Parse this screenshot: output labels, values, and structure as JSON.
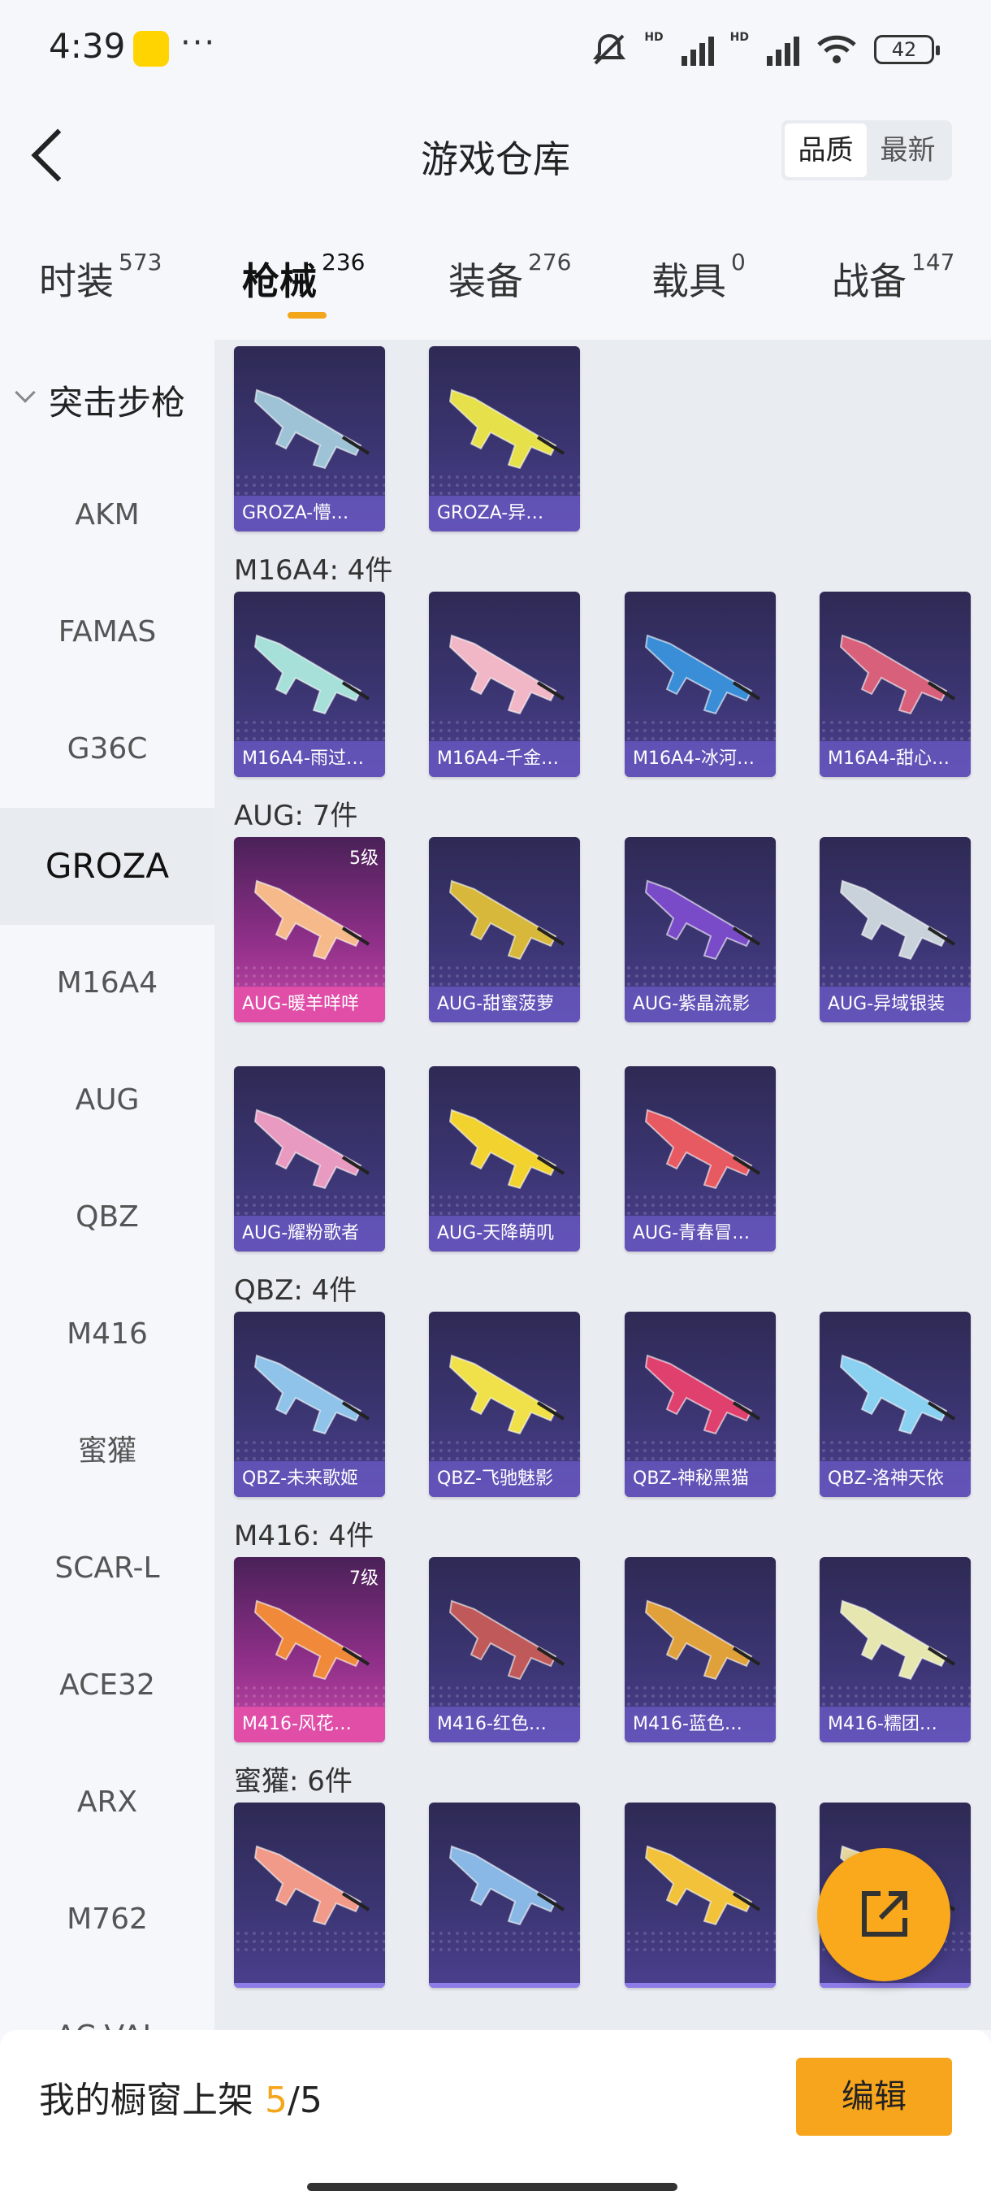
{
  "status": {
    "time": "4:39",
    "battery": "42",
    "hd1": "HD",
    "hd2": "HD"
  },
  "header": {
    "title": "游戏仓库",
    "seg": [
      "品质",
      "最新"
    ]
  },
  "tabs": [
    {
      "label": "时装",
      "count": "573"
    },
    {
      "label": "枪械",
      "count": "236"
    },
    {
      "label": "装备",
      "count": "276"
    },
    {
      "label": "载具",
      "count": "0"
    },
    {
      "label": "战备",
      "count": "147"
    }
  ],
  "sidebar": {
    "group": "突击步枪",
    "items": [
      "AKM",
      "FAMAS",
      "G36C",
      "GROZA",
      "M16A4",
      "AUG",
      "QBZ",
      "M416",
      "蜜獾",
      "SCAR-L",
      "ACE32",
      "ARX",
      "M762",
      "AC-VAL"
    ]
  },
  "sections": [
    {
      "title": "",
      "items": [
        {
          "name": "GROZA-懵…",
          "tone": "#9fc3d6",
          "level": ""
        },
        {
          "name": "GROZA-异…",
          "tone": "#e6e04a",
          "level": ""
        }
      ]
    },
    {
      "title": "M16A4: 4件",
      "items": [
        {
          "name": "M16A4-雨过…",
          "tone": "#a6e0d8",
          "level": ""
        },
        {
          "name": "M16A4-千金…",
          "tone": "#f2b7c6",
          "level": ""
        },
        {
          "name": "M16A4-冰河…",
          "tone": "#3a8ed8",
          "level": ""
        },
        {
          "name": "M16A4-甜心…",
          "tone": "#d8607a",
          "level": ""
        }
      ]
    },
    {
      "title": "AUG: 7件",
      "items": [
        {
          "name": "AUG-暖羊咩咩",
          "tone": "#f6b98a",
          "level": "5级"
        },
        {
          "name": "AUG-甜蜜菠萝",
          "tone": "#d8b83a",
          "level": ""
        },
        {
          "name": "AUG-紫晶流影",
          "tone": "#7a4bc8",
          "level": ""
        },
        {
          "name": "AUG-异域银装",
          "tone": "#c9d2da",
          "level": ""
        },
        {
          "name": "AUG-耀粉歌者",
          "tone": "#e89ac0",
          "level": ""
        },
        {
          "name": "AUG-天降萌叽",
          "tone": "#f2d22e",
          "level": ""
        },
        {
          "name": "AUG-青春冒…",
          "tone": "#e85a62",
          "level": ""
        }
      ]
    },
    {
      "title": "QBZ: 4件",
      "items": [
        {
          "name": "QBZ-未来歌姬",
          "tone": "#8fc3ea",
          "level": ""
        },
        {
          "name": "QBZ-飞驰魅影",
          "tone": "#f0e04a",
          "level": ""
        },
        {
          "name": "QBZ-神秘黑猫",
          "tone": "#e0406e",
          "level": ""
        },
        {
          "name": "QBZ-洛神天依",
          "tone": "#8ad0f0",
          "level": ""
        }
      ]
    },
    {
      "title": "M416: 4件",
      "items": [
        {
          "name": "M416-风花…",
          "tone": "#f08a3a",
          "level": "7级"
        },
        {
          "name": "M416-红色…",
          "tone": "#c05a5a",
          "level": ""
        },
        {
          "name": "M416-蓝色…",
          "tone": "#e0a03a",
          "level": ""
        },
        {
          "name": "M416-糯团…",
          "tone": "#e6e6b0",
          "level": ""
        }
      ]
    },
    {
      "title": "蜜獾: 6件",
      "items": [
        {
          "name": "",
          "tone": "#f29a8a",
          "level": ""
        },
        {
          "name": "",
          "tone": "#8ab8e6",
          "level": ""
        },
        {
          "name": "",
          "tone": "#f2c23a",
          "level": ""
        },
        {
          "name": "",
          "tone": "#e6d6a0",
          "level": ""
        }
      ]
    }
  ],
  "bottom": {
    "prefix": "我的橱窗上架 ",
    "current": "5",
    "sep": "/",
    "total": "5",
    "edit": "编辑"
  },
  "colors": {
    "accent": "#f4a61a",
    "card_purple": "#3b3572",
    "card_pink": "#c448a8"
  }
}
